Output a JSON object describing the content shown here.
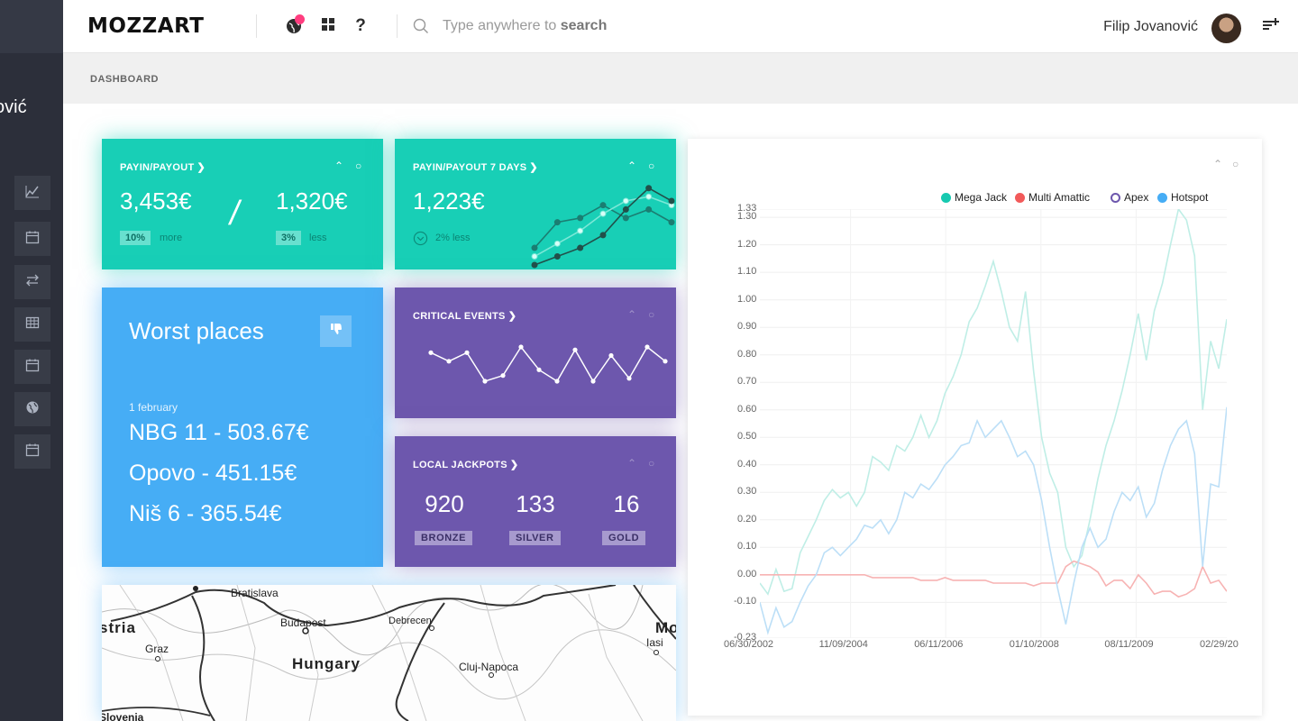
{
  "sidebar": {
    "user_partial": "ović",
    "items": [
      {
        "icon": "chart-line-icon"
      },
      {
        "icon": "calendar-icon"
      },
      {
        "icon": "transfer-arrows-icon"
      },
      {
        "icon": "table-icon"
      },
      {
        "icon": "calendar-icon"
      },
      {
        "icon": "globe-icon"
      },
      {
        "icon": "calendar-icon"
      }
    ]
  },
  "topbar": {
    "logo": "MOZZART",
    "search_prefix": "Type anywhere to ",
    "search_bold": "search",
    "user_name": "Filip Jovanović"
  },
  "breadcrumb": "DASHBOARD",
  "cards": {
    "payin": {
      "title": "PAYIN/PAYOUT",
      "value_left": "3,453€",
      "separator": "/",
      "value_right": "1,320€",
      "pill_left": "10%",
      "note_left": "more",
      "pill_right": "3%",
      "note_right": "less"
    },
    "payin7": {
      "title": "PAYIN/PAYOUT 7 DAYS",
      "value": "1,223€",
      "note": "2% less"
    },
    "worst": {
      "title": "Worst places",
      "date": "1 february",
      "lines": [
        {
          "place": "NBG 11 - ",
          "amount": "503.67€"
        },
        {
          "place": "Opovo - ",
          "amount": "451.15€"
        },
        {
          "place": "Niš 6 - ",
          "amount": "365.54€"
        }
      ]
    },
    "critical": {
      "title": "CRITICAL EVENTS"
    },
    "jackpots": {
      "title": "LOCAL JACKPOTS",
      "items": [
        {
          "value": "920",
          "label": "BRONZE"
        },
        {
          "value": "133",
          "label": "SILVER"
        },
        {
          "value": "16",
          "label": "GOLD"
        }
      ]
    },
    "map": {
      "labels": [
        "Bratislava",
        "stria",
        "Budapest",
        "Debrecen",
        "Mo",
        "Iasi",
        "Graz",
        "Hungary",
        "Cluj-Napoca",
        "Slovenia"
      ]
    }
  },
  "chart_data": {
    "type": "line",
    "legend": [
      {
        "name": "Mega Jack",
        "color": "#17c9b0"
      },
      {
        "name": "Multi Amattic",
        "color": "#f25a5a"
      },
      {
        "name": "Apex",
        "color": "#6d57ad"
      },
      {
        "name": "Hotspot",
        "color": "#46adf5"
      }
    ],
    "y_ticks": [
      "1.33",
      "1.30",
      "1.20",
      "1.10",
      "1.00",
      "0.90",
      "0.80",
      "0.70",
      "0.60",
      "0.50",
      "0.40",
      "0.30",
      "0.20",
      "0.10",
      "0.00",
      "-0.10",
      "-0.23"
    ],
    "x_ticks": [
      "06/30/2002",
      "11/09/2004",
      "06/11/2006",
      "01/10/2008",
      "08/11/2009",
      "02/29/20"
    ],
    "ylim": [
      -0.23,
      1.33
    ],
    "series": [
      {
        "name": "Mega Jack",
        "color": "#bfeee6",
        "values": [
          -0.03,
          -0.07,
          0.02,
          -0.06,
          -0.05,
          0.08,
          0.14,
          0.2,
          0.27,
          0.31,
          0.28,
          0.3,
          0.25,
          0.3,
          0.43,
          0.41,
          0.38,
          0.47,
          0.45,
          0.5,
          0.58,
          0.5,
          0.56,
          0.66,
          0.72,
          0.8,
          0.92,
          0.97,
          1.05,
          1.14,
          1.03,
          0.9,
          0.85,
          1.03,
          0.74,
          0.5,
          0.37,
          0.3,
          0.1,
          0.03,
          0.07,
          0.2,
          0.35,
          0.47,
          0.56,
          0.67,
          0.8,
          0.95,
          0.78,
          0.96,
          1.06,
          1.2,
          1.33,
          1.29,
          1.16,
          0.6,
          0.85,
          0.75,
          0.93
        ]
      },
      {
        "name": "Multi Amattic",
        "color": "#f7b3b3",
        "values": [
          0.0,
          0.0,
          0.0,
          0.0,
          0.0,
          0.0,
          0.0,
          0.0,
          0.0,
          0.0,
          0.0,
          0.0,
          0.0,
          0.0,
          -0.01,
          -0.01,
          -0.01,
          -0.01,
          -0.01,
          -0.01,
          -0.02,
          -0.02,
          -0.02,
          -0.01,
          -0.02,
          -0.02,
          -0.02,
          -0.02,
          -0.02,
          -0.03,
          -0.03,
          -0.03,
          -0.03,
          -0.03,
          -0.04,
          -0.03,
          -0.03,
          -0.03,
          0.03,
          0.05,
          0.04,
          0.03,
          0.01,
          -0.04,
          -0.02,
          -0.02,
          -0.05,
          0.0,
          -0.03,
          -0.07,
          -0.06,
          -0.06,
          -0.08,
          -0.07,
          -0.05,
          0.03,
          -0.03,
          -0.02,
          -0.06
        ]
      },
      {
        "name": "Hotspot",
        "color": "#bcdff7",
        "values": [
          -0.1,
          -0.21,
          -0.12,
          -0.19,
          -0.17,
          -0.1,
          -0.04,
          0.0,
          0.08,
          0.1,
          0.07,
          0.1,
          0.13,
          0.18,
          0.17,
          0.2,
          0.15,
          0.2,
          0.3,
          0.28,
          0.33,
          0.31,
          0.35,
          0.4,
          0.43,
          0.47,
          0.48,
          0.56,
          0.5,
          0.53,
          0.56,
          0.5,
          0.43,
          0.45,
          0.4,
          0.27,
          0.1,
          -0.05,
          -0.18,
          -0.03,
          0.1,
          0.17,
          0.1,
          0.13,
          0.23,
          0.3,
          0.27,
          0.32,
          0.21,
          0.26,
          0.38,
          0.47,
          0.53,
          0.56,
          0.44,
          0.03,
          0.33,
          0.32,
          0.61
        ]
      }
    ]
  },
  "sparkline_payin7": {
    "series_a": [
      2,
      5,
      5.5,
      7,
      5.5,
      6.5,
      5
    ],
    "series_b": [
      1,
      2.5,
      4,
      6,
      7.5,
      8,
      7
    ],
    "series_c": [
      0,
      1,
      2,
      3.5,
      6.5,
      9,
      7.5
    ]
  },
  "sparkline_critical": {
    "values": [
      5,
      3.5,
      5,
      0,
      1,
      6,
      2,
      0,
      5.5,
      0,
      4.5,
      0.5,
      6,
      3.5
    ]
  }
}
